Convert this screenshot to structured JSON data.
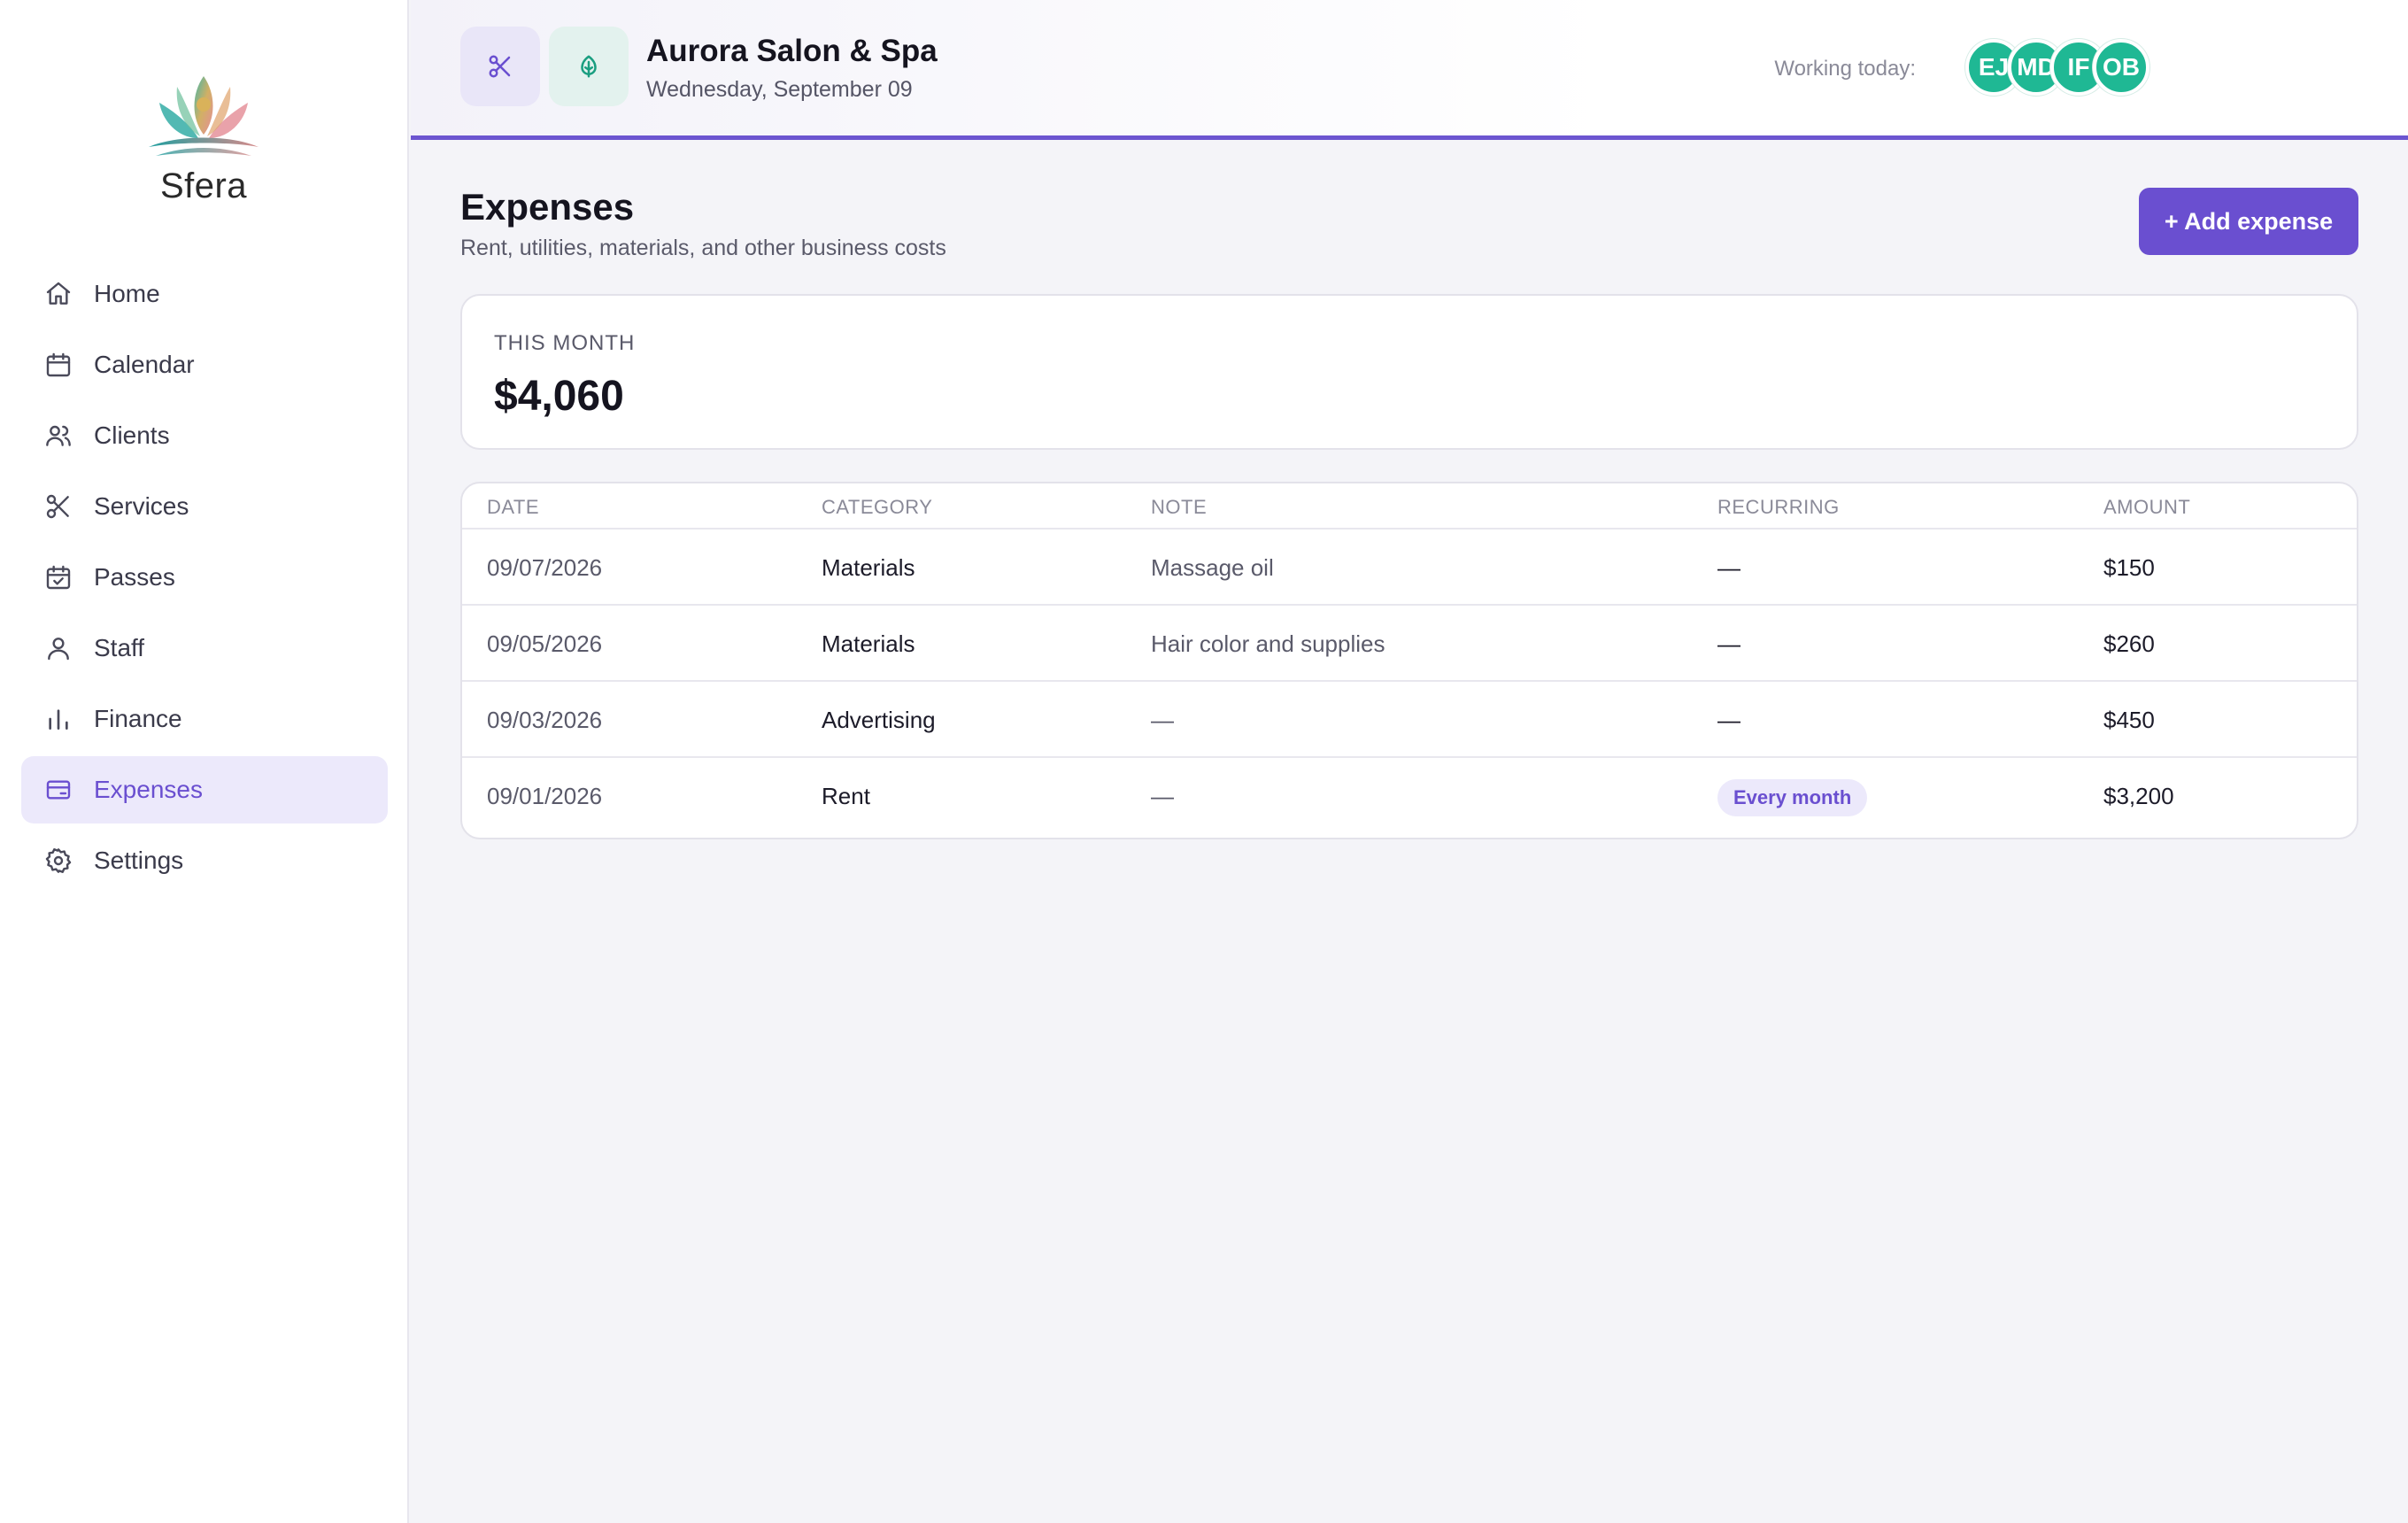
{
  "brand": {
    "name": "Sfera"
  },
  "sidebar": {
    "items": [
      {
        "label": "Home",
        "icon": "home-icon"
      },
      {
        "label": "Calendar",
        "icon": "calendar-icon"
      },
      {
        "label": "Clients",
        "icon": "users-icon"
      },
      {
        "label": "Services",
        "icon": "scissors-icon"
      },
      {
        "label": "Passes",
        "icon": "calendar-check-icon"
      },
      {
        "label": "Staff",
        "icon": "user-icon"
      },
      {
        "label": "Finance",
        "icon": "bar-chart-icon"
      },
      {
        "label": "Expenses",
        "icon": "credit-card-icon",
        "active": true
      },
      {
        "label": "Settings",
        "icon": "gear-icon"
      }
    ]
  },
  "header": {
    "salon_name": "Aurora Salon & Spa",
    "date": "Wednesday, September 09",
    "working_label": "Working today:",
    "staff_avatars": [
      "EJ",
      "MD",
      "IF",
      "OB"
    ]
  },
  "page": {
    "title": "Expenses",
    "subtitle": "Rent, utilities, materials, and other business costs",
    "add_button": "+ Add expense"
  },
  "summary": {
    "label": "THIS MONTH",
    "value": "$4,060"
  },
  "table": {
    "columns": [
      "DATE",
      "CATEGORY",
      "NOTE",
      "RECURRING",
      "AMOUNT"
    ],
    "rows": [
      {
        "date": "09/07/2026",
        "category": "Materials",
        "note": "Massage oil",
        "recurring": "—",
        "amount": "$150"
      },
      {
        "date": "09/05/2026",
        "category": "Materials",
        "note": "Hair color and supplies",
        "recurring": "—",
        "amount": "$260"
      },
      {
        "date": "09/03/2026",
        "category": "Advertising",
        "note": "—",
        "recurring": "—",
        "amount": "$450"
      },
      {
        "date": "09/01/2026",
        "category": "Rent",
        "note": "—",
        "recurring": "Every month",
        "amount": "$3,200"
      }
    ]
  },
  "colors": {
    "accent": "#6a4fd0",
    "accent_light": "#ece9fb",
    "avatar": "#1fb894",
    "background": "#f4f4f8"
  }
}
